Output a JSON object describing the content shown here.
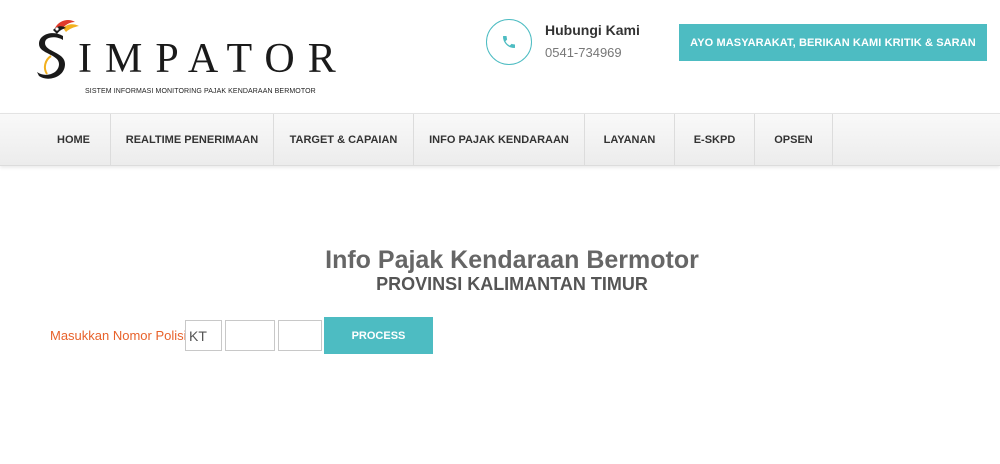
{
  "brand": {
    "name": "IMPATOR",
    "tagline": "SISTEM INFORMASI MONITORING PAJAK KENDARAAN BERMOTOR",
    "logo_icon": "simpator-logo-icon"
  },
  "contact": {
    "title": "Hubungi Kami",
    "phone": "0541-734969",
    "icon": "phone-icon"
  },
  "cta": {
    "label": "AYO MASYARAKAT, BERIKAN KAMI KRITIK & SARAN"
  },
  "nav": {
    "items": [
      {
        "label": "HOME"
      },
      {
        "label": "REALTIME PENERIMAAN"
      },
      {
        "label": "TARGET & CAPAIAN"
      },
      {
        "label": "INFO PAJAK KENDARAAN"
      },
      {
        "label": "LAYANAN"
      },
      {
        "label": "E-SKPD"
      },
      {
        "label": "OPSEN"
      }
    ]
  },
  "main": {
    "title": "Info Pajak Kendaraan Bermotor",
    "subtitle": "PROVINSI KALIMANTAN TIMUR",
    "form": {
      "label": "Masukkan Nomor Polisi",
      "plate_prefix": "KT",
      "plate_number": "",
      "plate_suffix": "",
      "submit_label": "PROCESS"
    }
  },
  "colors": {
    "accent": "#4dbcc2",
    "label": "#e8622b"
  }
}
